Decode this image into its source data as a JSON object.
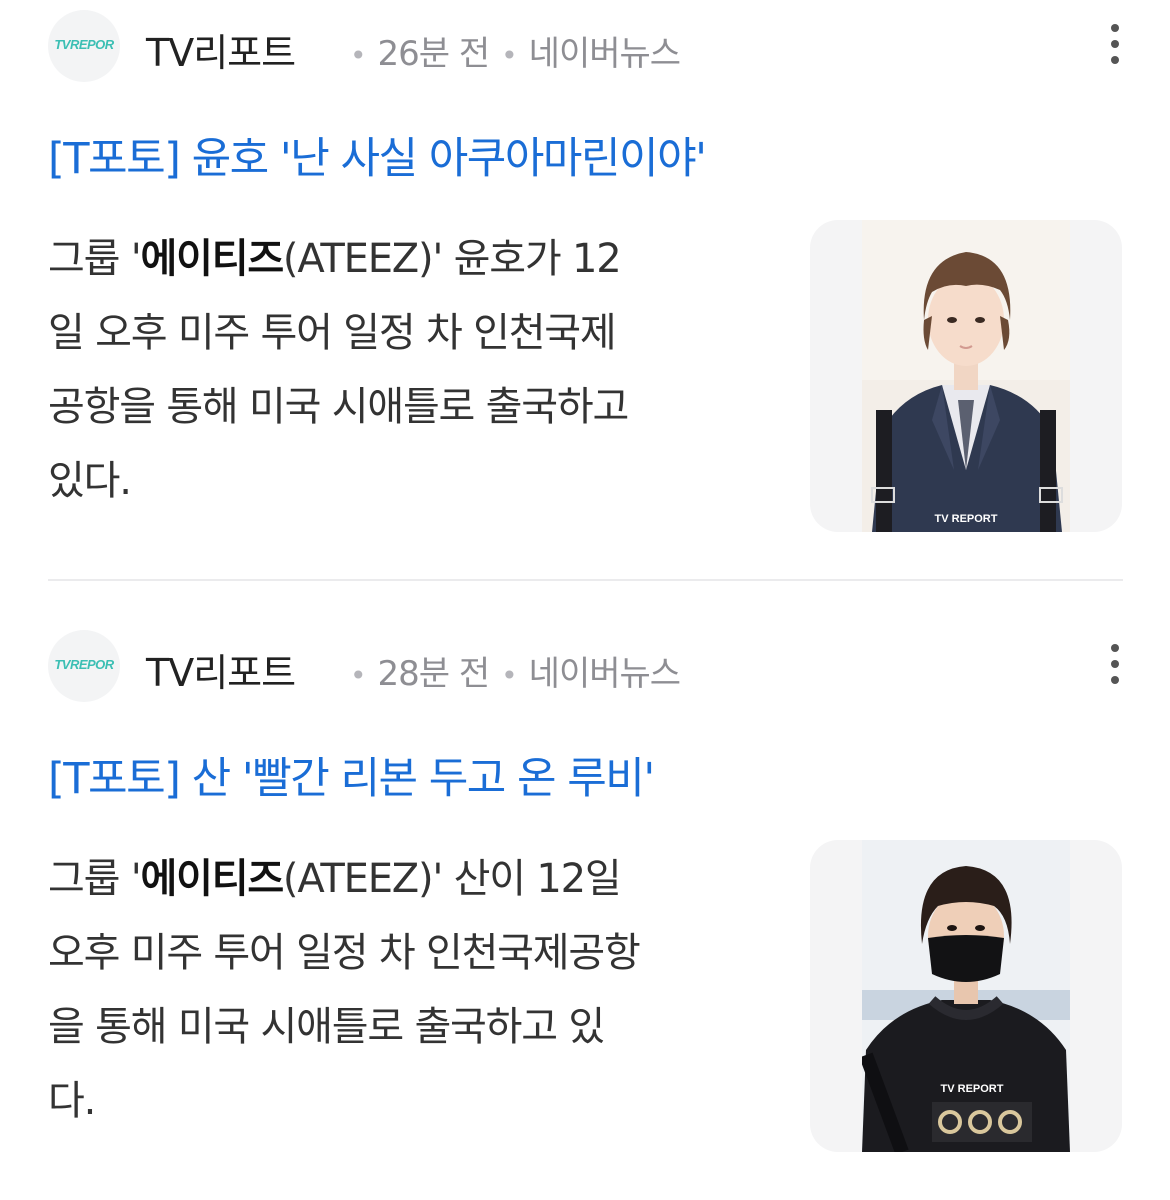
{
  "articles": [
    {
      "source": {
        "logo_text": "TVREPOR",
        "name": "TV리포트",
        "time": "26분 전",
        "platform": "네이버뉴스",
        "more_icon": "more-vertical-icon"
      },
      "headline": "[T포토] 윤호 '난 사실 아쿠아마린이야'",
      "body_lines": [
        {
          "pre": "그룹 '",
          "bold": "에이티즈",
          "post": "(ATEEZ)' 윤호가 12"
        },
        {
          "text": "일 오후 미주 투어 일정 차 인천국제"
        },
        {
          "text": "공항을 통해 미국 시애틀로 출국하고"
        },
        {
          "text": "있다."
        }
      ],
      "image": {
        "watermark": "TV REPORT",
        "subject": "person in navy suit"
      }
    },
    {
      "source": {
        "logo_text": "TVREPOR",
        "name": "TV리포트",
        "time": "28분 전",
        "platform": "네이버뉴스",
        "more_icon": "more-vertical-icon"
      },
      "headline": "[T포토] 산 '빨간 리본 두고 온 루비'",
      "body_lines": [
        {
          "pre": "그룹 '",
          "bold": "에이티즈",
          "post": "(ATEEZ)' 산이 12일"
        },
        {
          "text": "오후 미주 투어 일정 차 인천국제공항"
        },
        {
          "text": "을 통해 미국 시애틀로 출국하고 있"
        },
        {
          "text": "다."
        }
      ],
      "image": {
        "watermark": "TV REPORT",
        "subject": "person in black mask and hoodie"
      }
    }
  ],
  "colors": {
    "headline": "#1a6dd6",
    "meta": "#8e8e93",
    "logo": "#3cbfb4"
  }
}
